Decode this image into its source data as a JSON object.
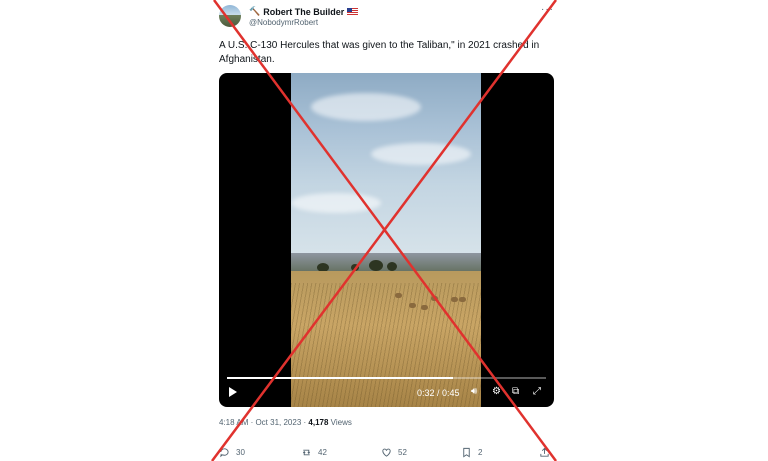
{
  "tweet": {
    "author_name": "Robert The Builder",
    "author_handle": "@NobodymrRobert",
    "author_prefix_icon": "hammer-icon",
    "author_flag_icon": "us-flag-icon",
    "more_label": "···",
    "text": "A U.S. C-130 Hercules that was given to the Taliban,\" in 2021 crashed in Afghanistan.",
    "timestamp": "4:18 AM · Oct 31, 2023 · ",
    "views_count": "4,178",
    "views_label": " Views"
  },
  "video": {
    "current_time": "0:32",
    "duration": "0:45",
    "time_display": "0:32 / 0:45",
    "progress_fraction": 0.71
  },
  "actions": {
    "replies": "30",
    "reposts": "42",
    "likes": "52",
    "bookmarks": "2"
  },
  "overlay": {
    "cross_color": "#e0322e"
  }
}
